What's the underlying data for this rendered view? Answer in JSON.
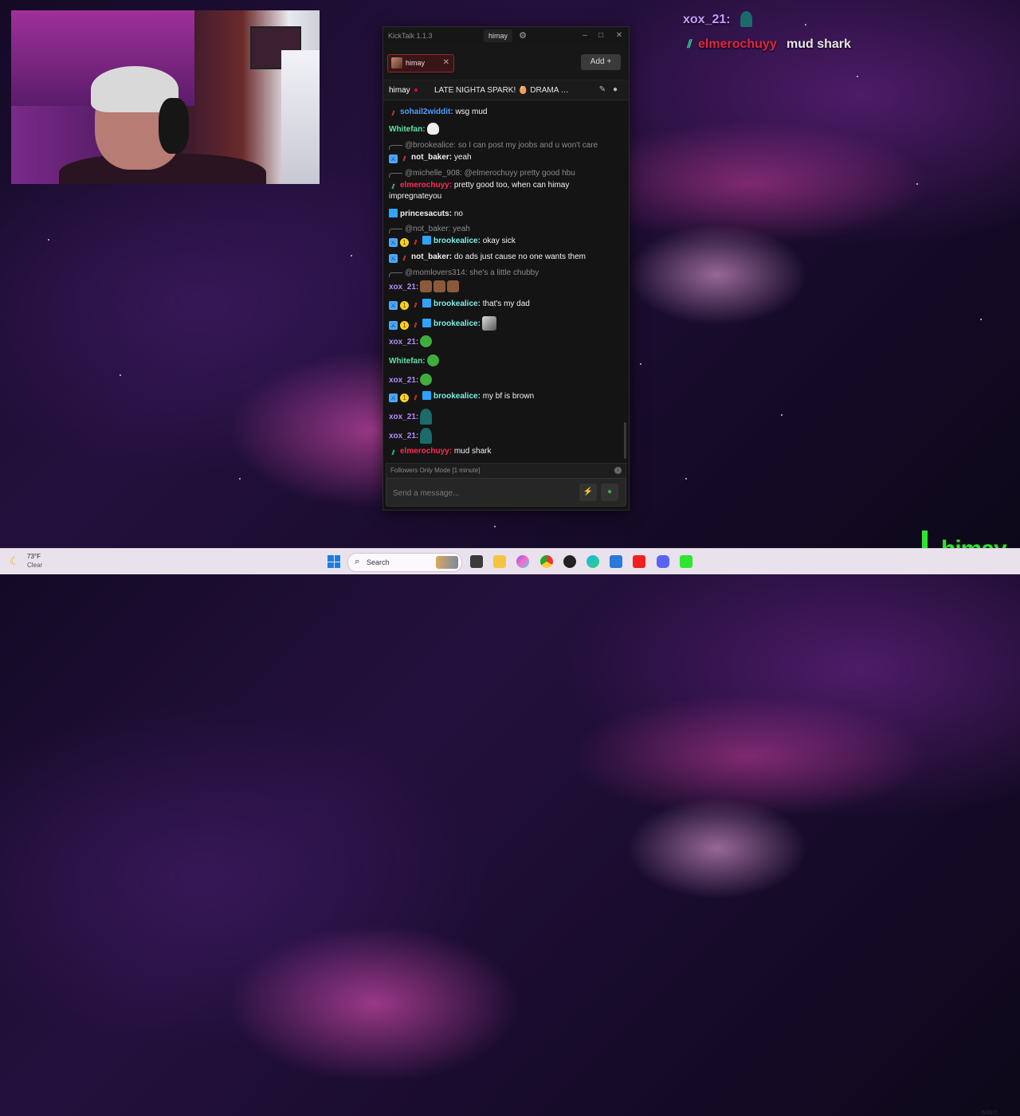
{
  "overlay": {
    "msg1_user": "xox_21:",
    "msg2_user": "elmerochuyy",
    "msg2_text": "mud shark"
  },
  "window": {
    "app_title": "KickTalk 1.1.3",
    "title_user": "himay",
    "minimize_symbol": "–",
    "maximize_symbol": "□",
    "close_symbol": "✕",
    "gear_icon": "⚙"
  },
  "tabs": [
    {
      "label": "himay",
      "close": "✕"
    }
  ],
  "add_button": "Add +",
  "channel": {
    "name": "himay",
    "title": "LATE NIGHTA SPARK! 🥚 DRAMA 🥚 L..."
  },
  "messages": [
    {
      "user": "sohail2widdit:",
      "text": "wsg mud"
    },
    {
      "user": "Whitefan:",
      "text": ""
    },
    {
      "reply": "@brookealice: so I can post my joobs and u won't care"
    },
    {
      "user": "not_baker:",
      "text": "yeah"
    },
    {
      "reply": "@michelle_908: @elmerochuyy pretty good hbu"
    },
    {
      "user": "elmerochuyy:",
      "text": "pretty good too, when can himay"
    },
    {
      "text_cont": "impregnateyou"
    },
    {
      "user": "princesacuts:",
      "text": "no"
    },
    {
      "reply": "@not_baker: yeah"
    },
    {
      "user": "brookealice:",
      "text": "okay sick"
    },
    {
      "user": "not_baker:",
      "text": "do ads just cause no one wants them"
    },
    {
      "reply": "@momlovers314: she's a little chubby"
    },
    {
      "user": "xox_21:",
      "text": ""
    },
    {
      "user": "brookealice:",
      "text": "that's my dad"
    },
    {
      "user": "brookealice:",
      "text": ""
    },
    {
      "user": "xox_21:",
      "text": ""
    },
    {
      "user": "Whitefan:",
      "text": ""
    },
    {
      "user": "xox_21:",
      "text": ""
    },
    {
      "user": "brookealice:",
      "text": "my bf is brown"
    },
    {
      "user": "xox_21:",
      "text": ""
    },
    {
      "user": "xox_21:",
      "text": ""
    },
    {
      "user": "elmerochuyy:",
      "text": "mud shark"
    }
  ],
  "followers_mode": "Followers Only Mode [1 minute]",
  "input": {
    "placeholder": "Send a message..."
  },
  "taskbar": {
    "temp": "73°F",
    "condition": "Clear",
    "search_label": "Search"
  },
  "overlay_name": "himay",
  "clock_date": "5/31/2",
  "colors": {
    "kick_green": "#2fe52f",
    "accent_red": "#e0283a"
  }
}
